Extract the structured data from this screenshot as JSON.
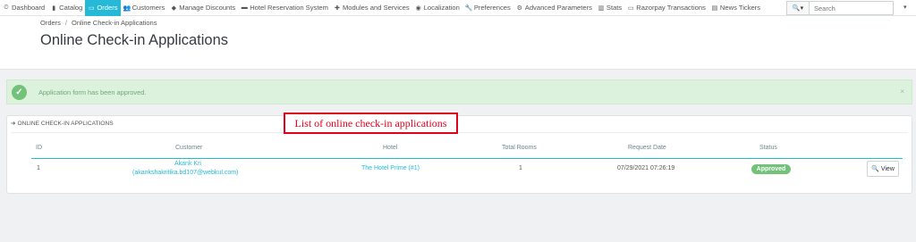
{
  "nav": {
    "items": [
      {
        "label": "Dashboard",
        "icon": "dashboard-icon",
        "glyph": "⏲"
      },
      {
        "label": "Catalog",
        "icon": "book-icon",
        "glyph": "▮"
      },
      {
        "label": "Orders",
        "icon": "credit-card-icon",
        "glyph": "▭",
        "active": true
      },
      {
        "label": "Customers",
        "icon": "users-icon",
        "glyph": "👥"
      },
      {
        "label": "Manage Discounts",
        "icon": "tag-icon",
        "glyph": "◆"
      },
      {
        "label": "Hotel Reservation System",
        "icon": "bed-icon",
        "glyph": "▬"
      },
      {
        "label": "Modules and Services",
        "icon": "puzzle-icon",
        "glyph": "✚"
      },
      {
        "label": "Localization",
        "icon": "globe-icon",
        "glyph": "◉"
      },
      {
        "label": "Preferences",
        "icon": "wrench-icon",
        "glyph": "🔧"
      },
      {
        "label": "Advanced Parameters",
        "icon": "cogs-icon",
        "glyph": "⚙"
      },
      {
        "label": "Stats",
        "icon": "bar-chart-icon",
        "glyph": "▥"
      },
      {
        "label": "Razorpay Transactions",
        "icon": "window-icon",
        "glyph": "▭"
      },
      {
        "label": "News Tickers",
        "icon": "newspaper-icon",
        "glyph": "▤"
      }
    ],
    "search_placeholder": "Search",
    "search_icon": "search-icon",
    "search_glyph": "🔍▾",
    "caret": "▾"
  },
  "breadcrumb": {
    "parent": "Orders",
    "separator": "/",
    "current": "Online Check-in Applications"
  },
  "page_title": "Online Check-in Applications",
  "alert": {
    "message": "Application form has been approved.",
    "close": "×",
    "check": "✓"
  },
  "panel": {
    "title": "ONLINE CHECK-IN APPLICATIONS",
    "title_glyph": "➔",
    "annotation": "List of online check-in applications",
    "columns": [
      "ID",
      "Customer",
      "Hotel",
      "Total Rooms",
      "Request Date",
      "Status"
    ],
    "rows": [
      {
        "id": "1",
        "customer_name": "Akank Kri",
        "customer_email": "(akankshakritika.bd107@webkul.com)",
        "hotel": "The Hotel Prime (#1)",
        "total_rooms": "1",
        "request_date": "07/29/2021 07:26:19",
        "status": "Approved",
        "action": "View"
      }
    ]
  },
  "colors": {
    "accent": "#25b9d7",
    "success": "#72c279",
    "annotation_red": "#e3001b"
  }
}
